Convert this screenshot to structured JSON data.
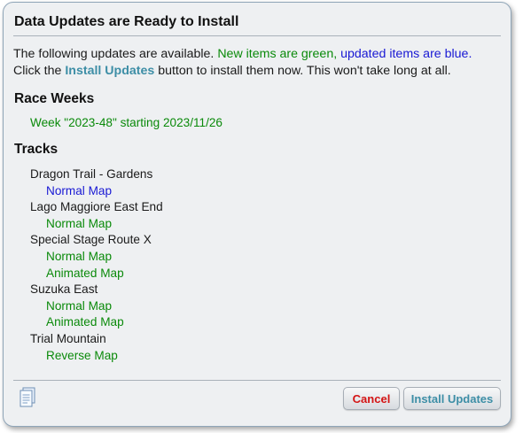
{
  "dialog": {
    "title": "Data Updates are Ready to Install",
    "intro": {
      "part1": "The following updates are available. ",
      "green_text": "New items are green,",
      "space": " ",
      "blue_text": "updated items are blue.",
      "line2_prefix": "Click the ",
      "install_link": "Install Updates",
      "line2_suffix": " button to install them now. This won't take long at all."
    },
    "race_weeks": {
      "heading": "Race Weeks",
      "week": "Week \"2023-48\" starting 2023/11/26"
    },
    "tracks": {
      "heading": "Tracks",
      "items": [
        {
          "name": "Dragon Trail - Gardens",
          "maps": [
            {
              "label": "Normal Map",
              "status": "updated"
            }
          ]
        },
        {
          "name": "Lago Maggiore East End",
          "maps": [
            {
              "label": "Normal Map",
              "status": "new"
            }
          ]
        },
        {
          "name": "Special Stage Route X",
          "maps": [
            {
              "label": "Normal Map",
              "status": "new"
            },
            {
              "label": "Animated Map",
              "status": "new"
            }
          ]
        },
        {
          "name": "Suzuka East",
          "maps": [
            {
              "label": "Normal Map",
              "status": "new"
            },
            {
              "label": "Animated Map",
              "status": "new"
            }
          ]
        },
        {
          "name": "Trial Mountain",
          "maps": [
            {
              "label": "Reverse Map",
              "status": "new"
            }
          ]
        }
      ]
    },
    "footer": {
      "icon": "document-icon",
      "cancel_label": "Cancel",
      "install_label": "Install Updates"
    },
    "colors": {
      "new": "#0a8a0a",
      "updated": "#1919d4",
      "cancel": "#d41414",
      "accent": "#3d8ea6"
    }
  }
}
